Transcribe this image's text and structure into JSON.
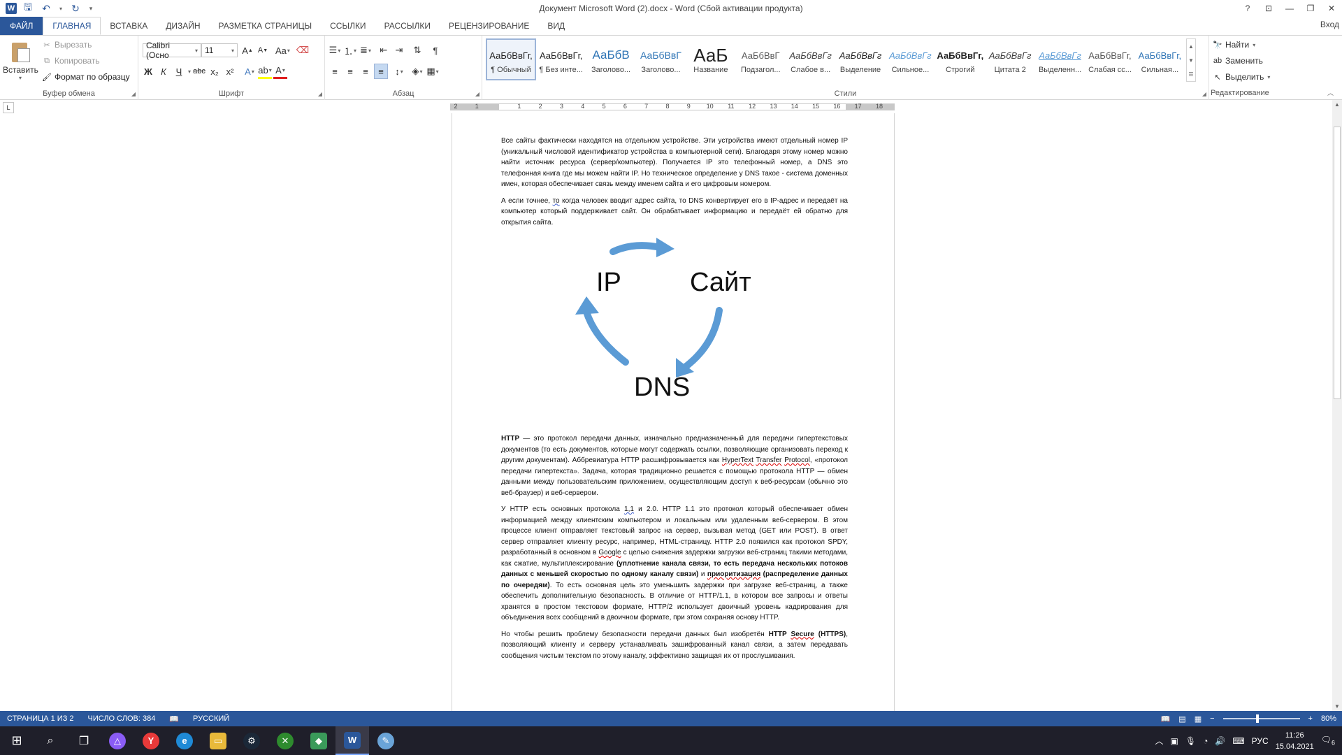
{
  "titlebar": {
    "title": "Документ Microsoft Word (2).docx - Word (Сбой активации продукта)",
    "help": "?",
    "restore_ribbon": "⊡",
    "minimize": "—",
    "maximize": "❐",
    "close": "✕"
  },
  "tabs": [
    "ФАЙЛ",
    "ГЛАВНАЯ",
    "ВСТАВКА",
    "ДИЗАЙН",
    "РАЗМЕТКА СТРАНИЦЫ",
    "ССЫЛКИ",
    "РАССЫЛКИ",
    "РЕЦЕНЗИРОВАНИЕ",
    "ВИД"
  ],
  "signin": "Вход",
  "clipboard": {
    "paste": "Вставить",
    "cut": "Вырезать",
    "copy": "Копировать",
    "format_painter": "Формат по образцу",
    "label": "Буфер обмена"
  },
  "font": {
    "name": "Calibri (Осно",
    "size": "11",
    "label": "Шрифт",
    "bold": "Ж",
    "italic": "К",
    "underline": "Ч",
    "strike": "abc",
    "sub": "x₂",
    "sup": "x²",
    "grow": "A",
    "shrink": "A",
    "case": "Aa",
    "color_a": "A"
  },
  "paragraph": {
    "label": "Абзац",
    "pilcrow": "¶"
  },
  "styles": {
    "label": "Стили",
    "items": [
      {
        "preview": "АаБбВвГг,",
        "name": "¶ Обычный",
        "color": "#222222"
      },
      {
        "preview": "АаБбВвГг,",
        "name": "¶ Без инте...",
        "color": "#222222"
      },
      {
        "preview": "АаБбВ",
        "name": "Заголово...",
        "color": "#2e74b5"
      },
      {
        "preview": "АаБбВвГ",
        "name": "Заголово...",
        "color": "#2e74b5"
      },
      {
        "preview": "АаБ",
        "name": "Название",
        "color": "#222222"
      },
      {
        "preview": "АаБбВвГ",
        "name": "Подзагол...",
        "color": "#595959"
      },
      {
        "preview": "АаБбВвГг",
        "name": "Слабое в...",
        "color": "#404040"
      },
      {
        "preview": "АаБбВвГг",
        "name": "Выделение",
        "color": "#222222"
      },
      {
        "preview": "АаБбВвГг",
        "name": "Сильное...",
        "color": "#5b9bd5"
      },
      {
        "preview": "АаБбВвГг,",
        "name": "Строгий",
        "color": "#222222"
      },
      {
        "preview": "АаБбВвГг",
        "name": "Цитата 2",
        "color": "#404040"
      },
      {
        "preview": "АаБбВвГг",
        "name": "Выделенн...",
        "color": "#5b9bd5"
      },
      {
        "preview": "АаБбВвГг,",
        "name": "Слабая сс...",
        "color": "#595959"
      },
      {
        "preview": "АаБбВвГг,",
        "name": "Сильная...",
        "color": "#2e74b5"
      }
    ]
  },
  "editing": {
    "find": "Найти",
    "replace": "Заменить",
    "select": "Выделить",
    "label": "Редактирование"
  },
  "ruler": {
    "labels": [
      "2",
      "1",
      "",
      "1",
      "2",
      "3",
      "4",
      "5",
      "6",
      "7",
      "8",
      "9",
      "10",
      "11",
      "12",
      "13",
      "14",
      "15",
      "16",
      "17",
      "18"
    ]
  },
  "tab_selector": "L",
  "document": {
    "p1": "Все сайты фактически находятся на отдельном устройстве. Эти устройства имеют отдельный номер IP (уникальный числовой идентификатор устройства в компьютерной сети). Благодаря этому номер можно найти источник ресурса (сервер/компьютер). Получается IP это телефонный номер, а DNS это телефонная книга где мы можем найти IP. Но техническое определение у DNS такое - система доменных имен, которая обеспечивает связь между именем сайта и его цифровым номером.",
    "p2_a": "А если точнее, ",
    "p2_to": "то",
    "p2_b": " когда человек вводит адрес сайта, то DNS конвертирует его в IP-адрес и передаёт на компьютер который поддерживает сайт. Он обрабатывает информацию и передаёт ей обратно для открытия сайта.",
    "diagram": {
      "ip": "IP",
      "site": "Сайт",
      "dns": "DNS",
      "arrow_color": "#5b9bd5"
    },
    "p3_http": "HTTP",
    "p3_a": " — это протокол передачи данных, изначально предназначенный для передачи гипертекстовых документов (то есть документов, которые могут содержать ссылки, позволяющие организовать переход к другим документам). Аббревиатура HTTP расшифровывается как ",
    "p3_hypertext": "HyperText",
    "p3_sp1": " ",
    "p3_transfer": "Transfer",
    "p3_sp2": " ",
    "p3_protocol": "Protocol",
    "p3_b": ", «протокол передачи гипертекста». Задача, которая традиционно решается с помощью протокола HTTP — обмен данными между пользовательским приложением, осуществляющим доступ к веб-ресурсам (обычно это веб-браузер) и веб-сервером.",
    "p4_a": "У HTTP есть основных протокола ",
    "p4_ver": "1,1",
    "p4_b": " и 2.0. HTTP 1.1 это протокол который обеспечивает обмен информацией между клиентским компьютером и локальным или удаленным веб-сервером. В этом процессе клиент отправляет текстовый запрос на сервер, вызывая метод (GET или POST). В ответ сервер отправляет клиенту ресурс, например, HTML-страницу. HTTP 2.0 появился как протокол SPDY, разработанный в основном в ",
    "p4_google": "Google",
    "p4_c": " с целью снижения задержки загрузки веб-страниц такими методами, как сжатие, мультиплексирование ",
    "p4_bold1": "(уплотнение канала связи, то есть передача нескольких потоков данных с меньшей скоростью по одному каналу связи)",
    "p4_and": " и ",
    "p4_prior": "приоритизация",
    "p4_bold2": " (распределение данных по очередям)",
    "p4_d": ".  То есть основная цель это уменьшить задержки при загрузке веб-страниц, а также обеспечить дополнительную безопасность. В отличие от HTTP/1.1, в котором все запросы и ответы хранятся в простом текстовом формате, HTTP/2 использует двоичный уровень кадрирования для объединения всех сообщений в двоичном формате, при этом сохраняя основу HTTP.",
    "p5_a": "Но чтобы решить проблему безопасности передачи данных был изобретён ",
    "p5_http": "HTTP ",
    "p5_secure": "Secure",
    "p5_https": " (HTTPS)",
    "p5_b": ", позволяющий клиенту и серверу устанавливать зашифрованный канал связи, а затем передавать сообщения чистым текстом по этому каналу, эффективно защищая их от прослушивания."
  },
  "statusbar": {
    "page": "СТРАНИЦА 1 ИЗ 2",
    "words": "ЧИСЛО СЛОВ: 384",
    "language": "РУССКИЙ",
    "zoom": "80%",
    "zoom_level": 0.45
  },
  "taskbar": {
    "lang": "РУС",
    "time": "11:26",
    "date": "15.04.2021",
    "notif_count": "6"
  }
}
